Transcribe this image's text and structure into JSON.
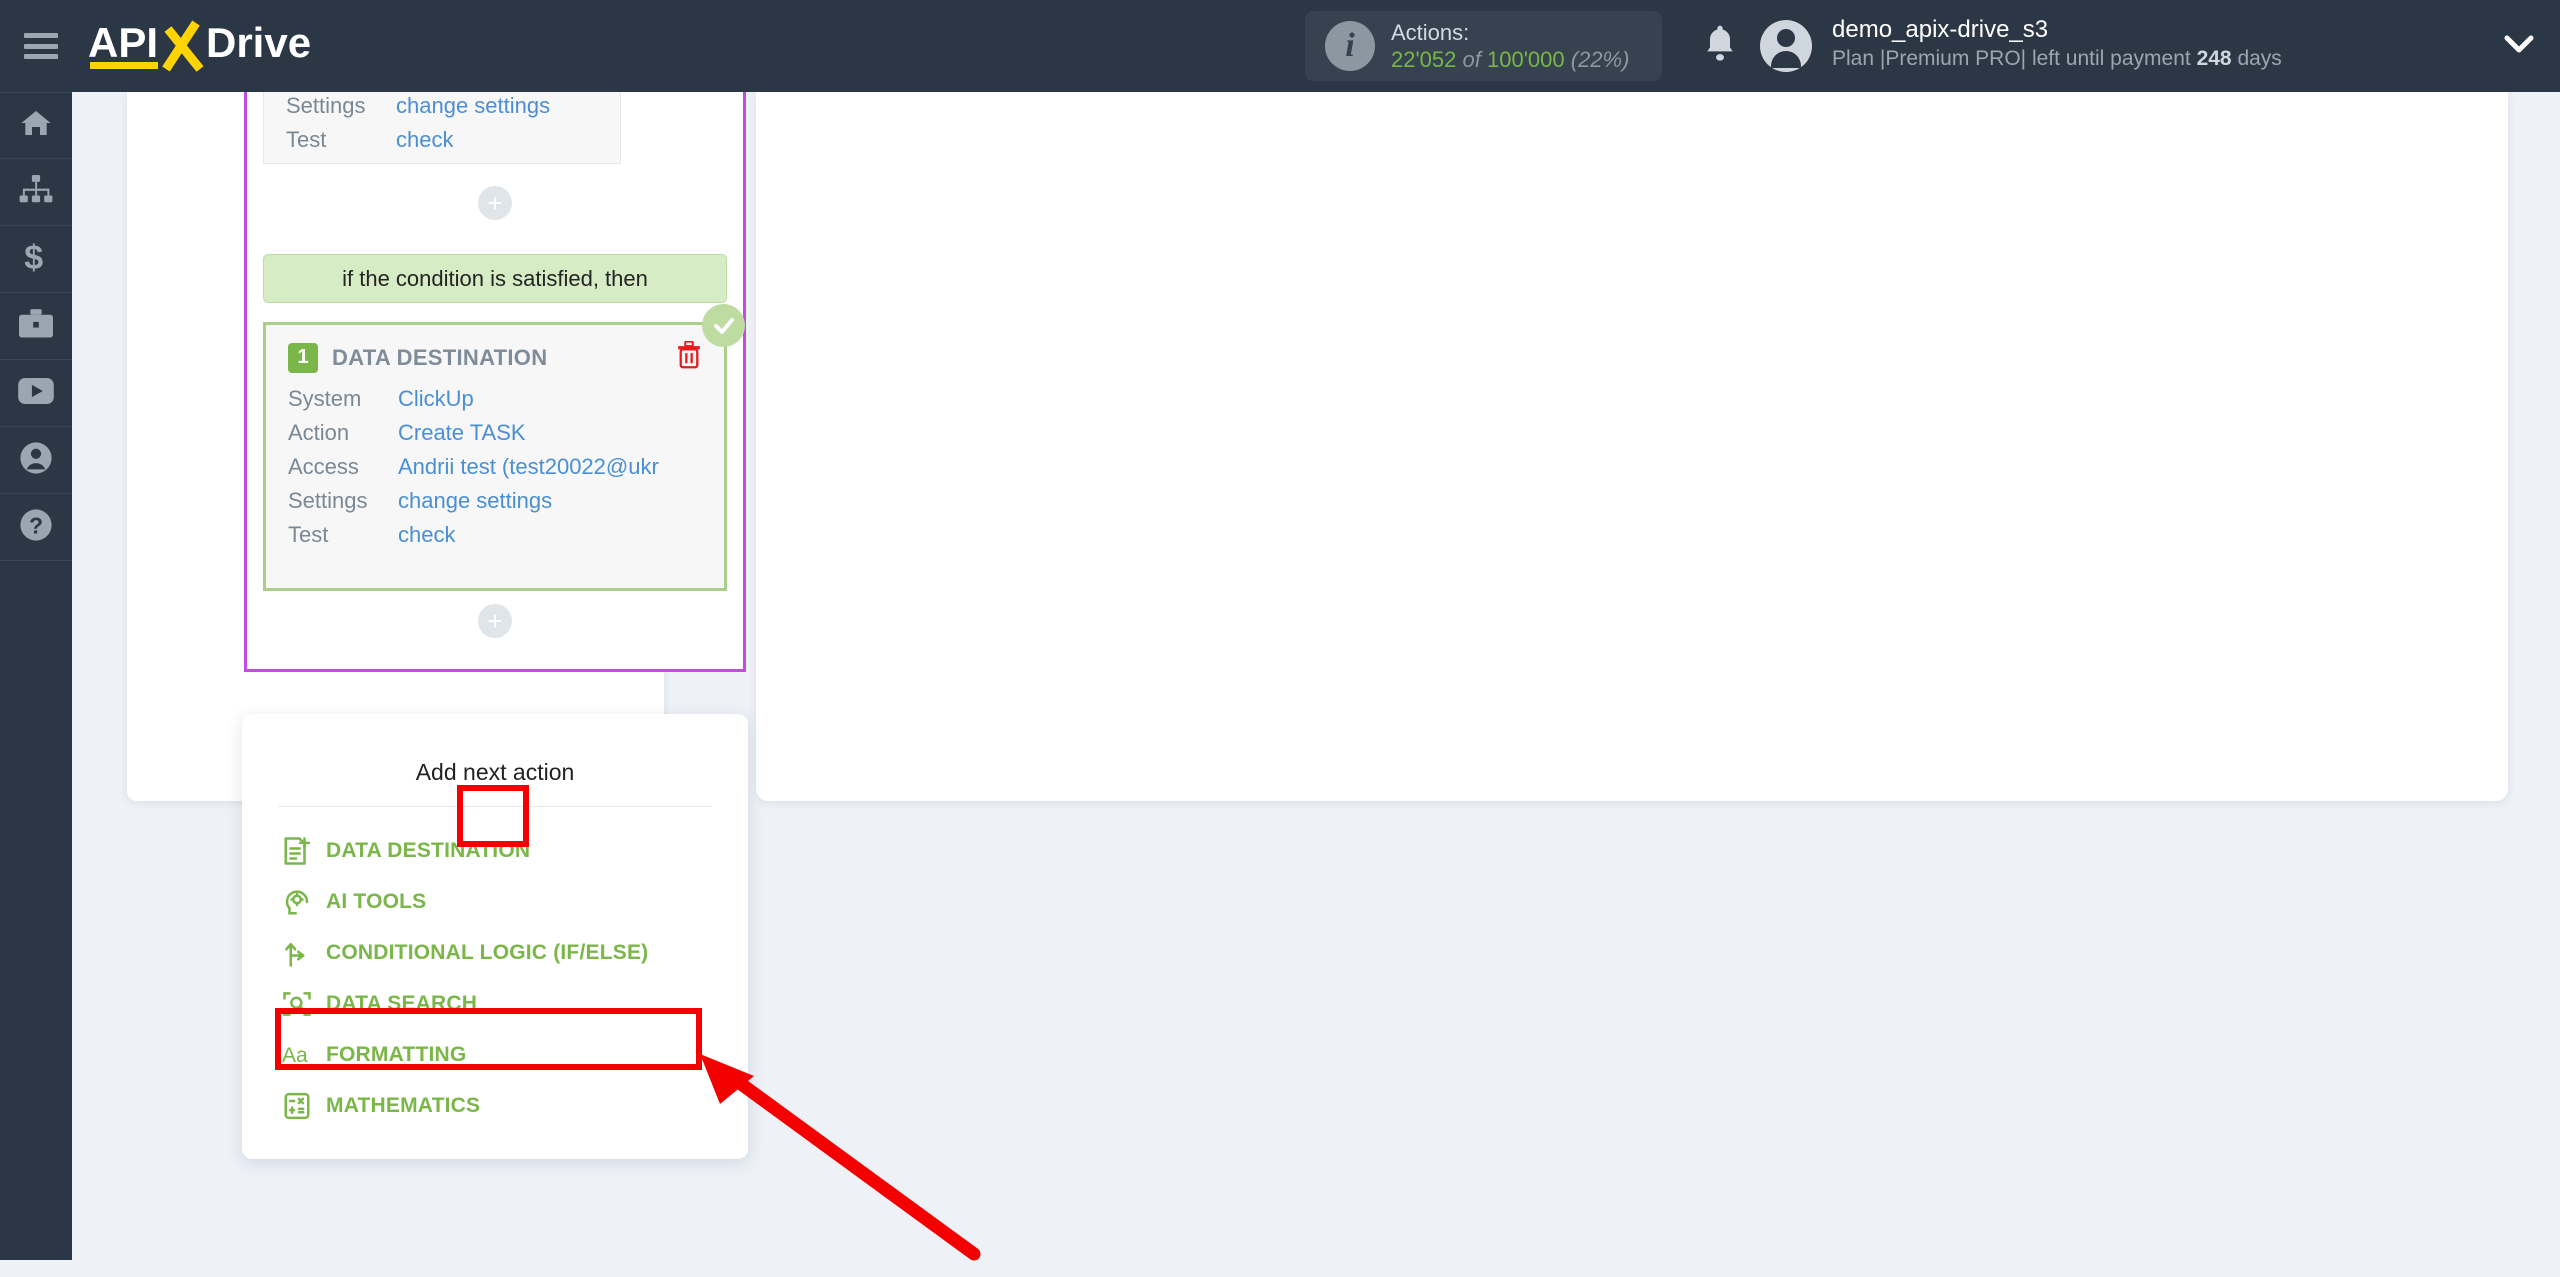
{
  "header": {
    "brand": "APIXDrive",
    "menu_icon": "hamburger-icon",
    "actions": {
      "label": "Actions:",
      "used": "22'052",
      "of": "of",
      "total": "100'000",
      "percent": "(22%)"
    },
    "notifications_icon": "bell-icon",
    "user": {
      "name": "demo_apix-drive_s3",
      "plan_prefix": "Plan |Premium PRO| left until payment",
      "days_value": "248",
      "days_suffix": "days"
    },
    "chevron_icon": "chevron-down-icon"
  },
  "sidebar": {
    "items": [
      {
        "name": "home",
        "icon": "home-icon"
      },
      {
        "name": "connections",
        "icon": "sitemap-icon"
      },
      {
        "name": "billing",
        "icon": "dollar-icon"
      },
      {
        "name": "tools",
        "icon": "briefcase-icon"
      },
      {
        "name": "video",
        "icon": "youtube-icon"
      },
      {
        "name": "account",
        "icon": "user-circle-icon"
      },
      {
        "name": "help",
        "icon": "question-circle-icon"
      }
    ]
  },
  "flow": {
    "top_card": {
      "rows": [
        {
          "key": "Settings",
          "value": "change settings"
        },
        {
          "key": "Test",
          "value": "check"
        }
      ]
    },
    "condition_banner": "if the condition is satisfied, then",
    "destination_card": {
      "number": "1",
      "title": "DATA DESTINATION",
      "delete_icon": "trash-icon",
      "status_icon": "check-circle-icon",
      "rows": [
        {
          "key": "System",
          "value": "ClickUp"
        },
        {
          "key": "Action",
          "value": "Create TASK"
        },
        {
          "key": "Access",
          "value": "Andrii test (test20022@ukr"
        },
        {
          "key": "Settings",
          "value": "change settings"
        },
        {
          "key": "Test",
          "value": "check"
        }
      ]
    },
    "add_button_label": "+"
  },
  "menu": {
    "title": "Add next action",
    "items": [
      {
        "label": "DATA DESTINATION",
        "icon": "document-plus-icon"
      },
      {
        "label": "AI TOOLS",
        "icon": "ai-head-icon"
      },
      {
        "label": "CONDITIONAL LOGIC (IF/ELSE)",
        "icon": "branch-icon"
      },
      {
        "label": "DATA SEARCH",
        "icon": "search-frame-icon"
      },
      {
        "label": "FORMATTING",
        "icon": "text-format-icon"
      },
      {
        "label": "MATHEMATICS",
        "icon": "calculator-icon"
      }
    ]
  },
  "annotations": {
    "highlight_plus": "red-box-around-add-button",
    "highlight_conditional": "red-box-around-conditional-logic",
    "arrow": "red-arrow-pointing-to-conditional-logic"
  },
  "colors": {
    "topbar": "#2b3744",
    "accent_green": "#7ab648",
    "accent_yellow": "#ffd400",
    "link_blue": "#4a8fd4",
    "purple_border": "#c24ce0",
    "annotation_red": "#f40000"
  }
}
